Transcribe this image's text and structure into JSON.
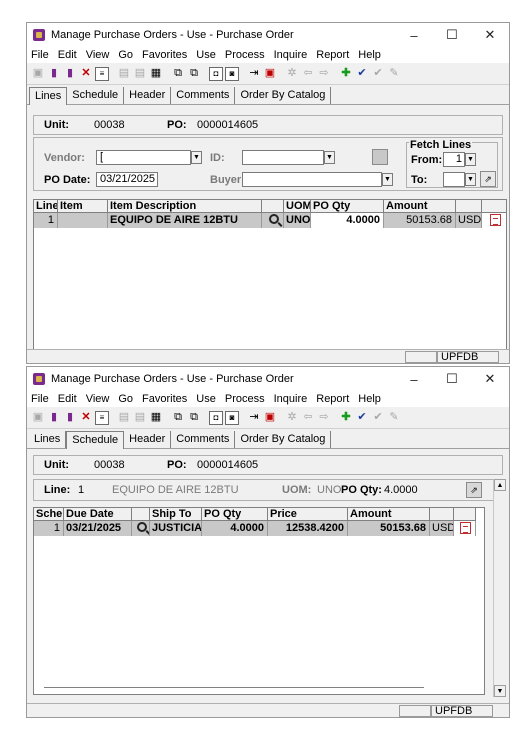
{
  "window1": {
    "title": "Manage Purchase Orders - Use - Purchase Order",
    "menu": [
      "File",
      "Edit",
      "View",
      "Go",
      "Favorites",
      "Use",
      "Process",
      "Inquire",
      "Report",
      "Help"
    ],
    "tabs": [
      "Lines",
      "Schedule",
      "Header",
      "Comments",
      "Order By Catalog"
    ],
    "active_tab": "Lines",
    "unit_label": "Unit:",
    "unit_value": "00038",
    "po_label": "PO:",
    "po_value": "0000014605",
    "vendor_label": "Vendor:",
    "vendor_value": "[",
    "id_label": "ID:",
    "id_value": "",
    "po_date_label": "PO Date:",
    "po_date_value": "03/21/2025",
    "buyer_label": "Buyer:",
    "buyer_value": "",
    "fetch_lines_label": "Fetch Lines",
    "from_label": "From:",
    "from_value": "1",
    "to_label": "To:",
    "to_value": "",
    "columns": [
      "Line",
      "Item",
      "Item Description",
      "",
      "UOM",
      "PO Qty",
      "Amount",
      "",
      ""
    ],
    "rows": [
      {
        "line": "1",
        "item": "",
        "description": "EQUIPO DE AIRE 12BTU",
        "uom": "UNO",
        "po_qty": "4.0000",
        "amount": "50153.68",
        "currency": "USD"
      }
    ],
    "status": "UPFDB"
  },
  "window2": {
    "title": "Manage Purchase Orders - Use - Purchase Order",
    "menu": [
      "File",
      "Edit",
      "View",
      "Go",
      "Favorites",
      "Use",
      "Process",
      "Inquire",
      "Report",
      "Help"
    ],
    "tabs": [
      "Lines",
      "Schedule",
      "Header",
      "Comments",
      "Order By Catalog"
    ],
    "active_tab": "Schedule",
    "unit_label": "Unit:",
    "unit_value": "00038",
    "po_label": "PO:",
    "po_value": "0000014605",
    "line_label": "Line:",
    "line_value": "1",
    "line_description": "EQUIPO DE AIRE 12BTU",
    "uom_label": "UOM:",
    "uom_value": "UNO",
    "po_qty_label": "PO Qty:",
    "po_qty_value": "4.0000",
    "columns": [
      "Sche",
      "Due Date",
      "",
      "Ship To",
      "PO Qty",
      "Price",
      "Amount",
      "",
      ""
    ],
    "rows": [
      {
        "sched": "1",
        "due_date": "03/21/2025",
        "ship_to": "JUSTICIA",
        "po_qty": "4.0000",
        "price": "12538.4200",
        "amount": "50153.68",
        "currency": "USD"
      }
    ],
    "status": "UPFDB"
  }
}
